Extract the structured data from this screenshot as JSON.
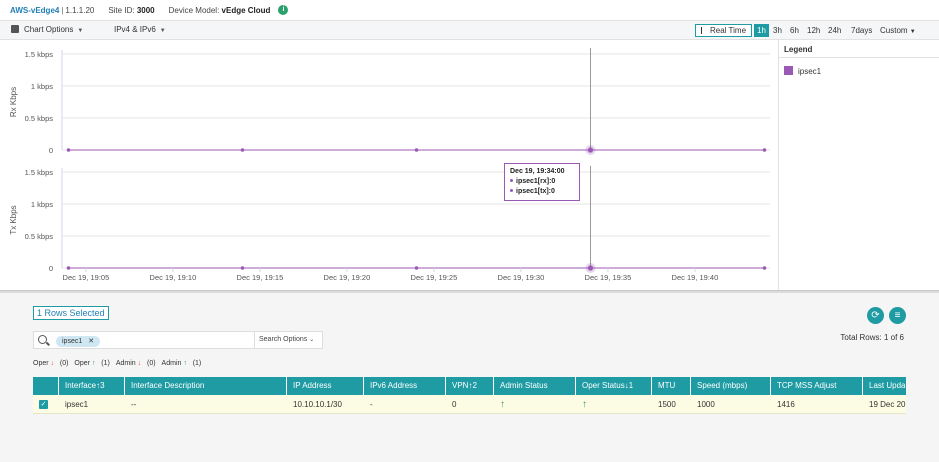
{
  "header": {
    "device_name": "AWS-vEdge4",
    "device_ip": "1.1.1.20",
    "site_label": "Site ID:",
    "site_id": "3000",
    "model_label": "Device Model:",
    "model": "vEdge Cloud",
    "info_icon": "info-icon"
  },
  "options": {
    "chart_options": "Chart Options",
    "ip_filter": "IPv4 & IPv6",
    "real_time": "Real Time",
    "ranges": [
      "1h",
      "3h",
      "6h",
      "12h",
      "24h",
      "7days",
      "Custom"
    ],
    "active_range": "1h"
  },
  "legend": {
    "title": "Legend",
    "items": [
      {
        "name": "ipsec1",
        "color": "#9b59b6"
      }
    ]
  },
  "tooltip": {
    "title": "Dec 19, 19:34:00",
    "rx": "ipsec1[rx]:0",
    "tx": "ipsec1[tx]:0"
  },
  "chart_data": [
    {
      "type": "line",
      "ylabel": "Rx Kbps",
      "yticks": [
        "1.5 kbps",
        "1 kbps",
        "0.5 kbps",
        "0"
      ],
      "ylim": [
        0,
        1.5
      ],
      "x": [
        "Dec 19, 19:04",
        "Dec 19, 19:14",
        "Dec 19, 19:24",
        "Dec 19, 19:34",
        "Dec 19, 19:44"
      ],
      "series": [
        {
          "name": "ipsec1",
          "values": [
            0,
            0,
            0,
            0,
            0
          ],
          "color": "#9b59b6"
        }
      ]
    },
    {
      "type": "line",
      "ylabel": "Tx Kbps",
      "yticks": [
        "1.5 kbps",
        "1 kbps",
        "0.5 kbps",
        "0"
      ],
      "ylim": [
        0,
        1.5
      ],
      "xticks": [
        "Dec 19, 19:05",
        "Dec 19, 19:10",
        "Dec 19, 19:15",
        "Dec 19, 19:20",
        "Dec 19, 19:25",
        "Dec 19, 19:30",
        "Dec 19, 19:35",
        "Dec 19, 19:40"
      ],
      "x": [
        "Dec 19, 19:04",
        "Dec 19, 19:14",
        "Dec 19, 19:24",
        "Dec 19, 19:34",
        "Dec 19, 19:44"
      ],
      "series": [
        {
          "name": "ipsec1",
          "values": [
            0,
            0,
            0,
            0,
            0
          ],
          "color": "#9b59b6"
        }
      ]
    }
  ],
  "table_panel": {
    "rows_selected": "1 Rows Selected",
    "total_rows": "Total Rows: 1 of 6",
    "search_chip": "ipsec1",
    "search_options": "Search Options",
    "filters": {
      "oper_down_label": "Oper",
      "oper_down_count": "(0)",
      "oper_up_label": "Oper",
      "oper_up_count": "(1)",
      "admin_down_label": "Admin",
      "admin_down_count": "(0)",
      "admin_up_label": "Admin",
      "admin_up_count": "(1)"
    },
    "columns": [
      "Interface↑3",
      "Interface Description",
      "IP Address",
      "IPv6 Address",
      "VPN↑2",
      "Admin Status",
      "Oper Status↓1",
      "MTU",
      "Speed (mbps)",
      "TCP MSS Adjust",
      "Last Upda"
    ],
    "row": {
      "interface": "ipsec1",
      "description": "--",
      "ip": "10.10.10.1/30",
      "ipv6": "-",
      "vpn": "0",
      "admin_status": "up",
      "oper_status": "up",
      "mtu": "1500",
      "speed": "1000",
      "tcp_mss": "1416",
      "last_updated": "19 Dec 20"
    }
  }
}
